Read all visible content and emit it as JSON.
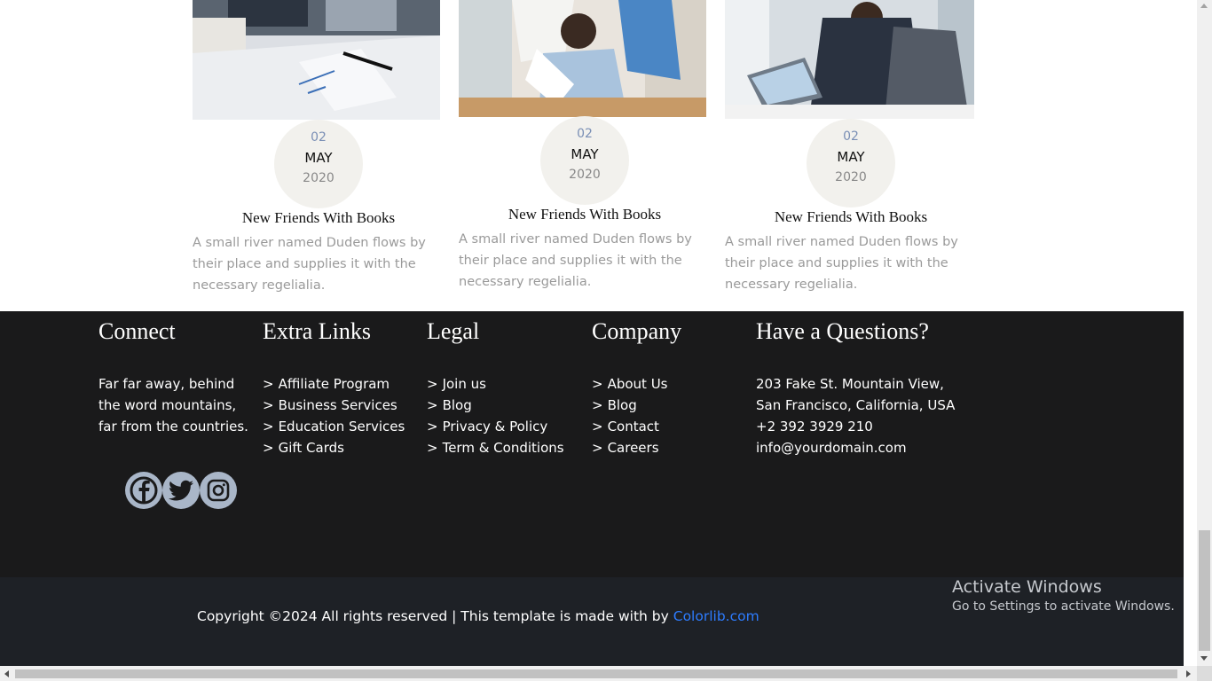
{
  "blog": {
    "posts": [
      {
        "day": "02",
        "month": "MAY",
        "year": "2020",
        "title": "New Friends With Books",
        "excerpt": "A small river named Duden flows by their place and supplies it with the necessary regelialia."
      },
      {
        "day": "02",
        "month": "MAY",
        "year": "2020",
        "title": "New Friends With Books",
        "excerpt": "A small river named Duden flows by their place and supplies it with the necessary regelialia."
      },
      {
        "day": "02",
        "month": "MAY",
        "year": "2020",
        "title": "New Friends With Books",
        "excerpt": "A small river named Duden flows by their place and supplies it with the necessary regelialia."
      }
    ]
  },
  "footer": {
    "connect": {
      "heading": "Connect",
      "text": "Far far away, behind the word mountains, far from the countries.",
      "social": [
        "facebook-icon",
        "twitter-icon",
        "instagram-icon"
      ]
    },
    "extra_links": {
      "heading": "Extra Links",
      "items": [
        "Affiliate Program",
        "Business Services",
        "Education Services",
        "Gift Cards"
      ]
    },
    "legal": {
      "heading": "Legal",
      "items": [
        "Join us",
        "Blog",
        "Privacy & Policy",
        "Term & Conditions"
      ]
    },
    "company": {
      "heading": "Company",
      "items": [
        "About Us",
        "Blog",
        "Contact",
        "Careers"
      ]
    },
    "questions": {
      "heading": "Have a Questions?",
      "address": "203 Fake St. Mountain View, San Francisco, California, USA",
      "phone": "+2 392 3929 210",
      "email": "info@yourdomain.com"
    },
    "arrow": ">",
    "copyright_text": "Copyright ©2024 All rights reserved | This template is made with by",
    "copyright_link": "Colorlib.com"
  },
  "os_overlay": {
    "activate_title": "Activate Windows",
    "activate_sub": "Go to Settings to activate Windows."
  },
  "colors": {
    "footer_bg": "#1a1a1b",
    "bottom_bg": "#1e2126",
    "link": "#2d7cff",
    "date_circle": "#f2f1ed",
    "social_bg": "#a9b6c8"
  }
}
